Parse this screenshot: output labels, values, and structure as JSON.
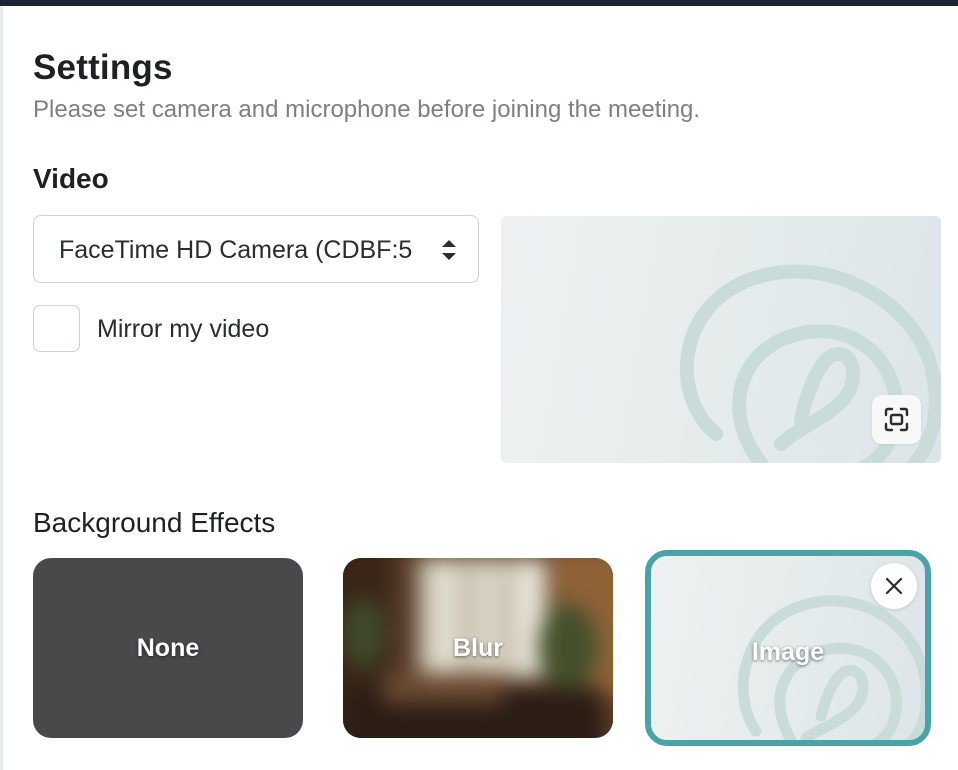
{
  "settings": {
    "title": "Settings",
    "subtitle": "Please set camera and microphone before joining the meeting."
  },
  "video": {
    "section_title": "Video",
    "camera_select": {
      "value": "FaceTime HD Camera (CDBF:5"
    },
    "mirror_checkbox": {
      "label": "Mirror my video",
      "checked": false
    }
  },
  "background_effects": {
    "section_title": "Background Effects",
    "options": [
      {
        "label": "None",
        "selected": false
      },
      {
        "label": "Blur",
        "selected": false
      },
      {
        "label": "Image",
        "selected": true
      }
    ]
  },
  "icons": {
    "select": "up-down-chevron-icon",
    "fullscreen": "fullscreen-icon",
    "remove": "close-icon"
  },
  "colors": {
    "selected_border": "#4aa3a6",
    "top_bar": "#1d2433",
    "swirl": "#c9dcd9"
  }
}
